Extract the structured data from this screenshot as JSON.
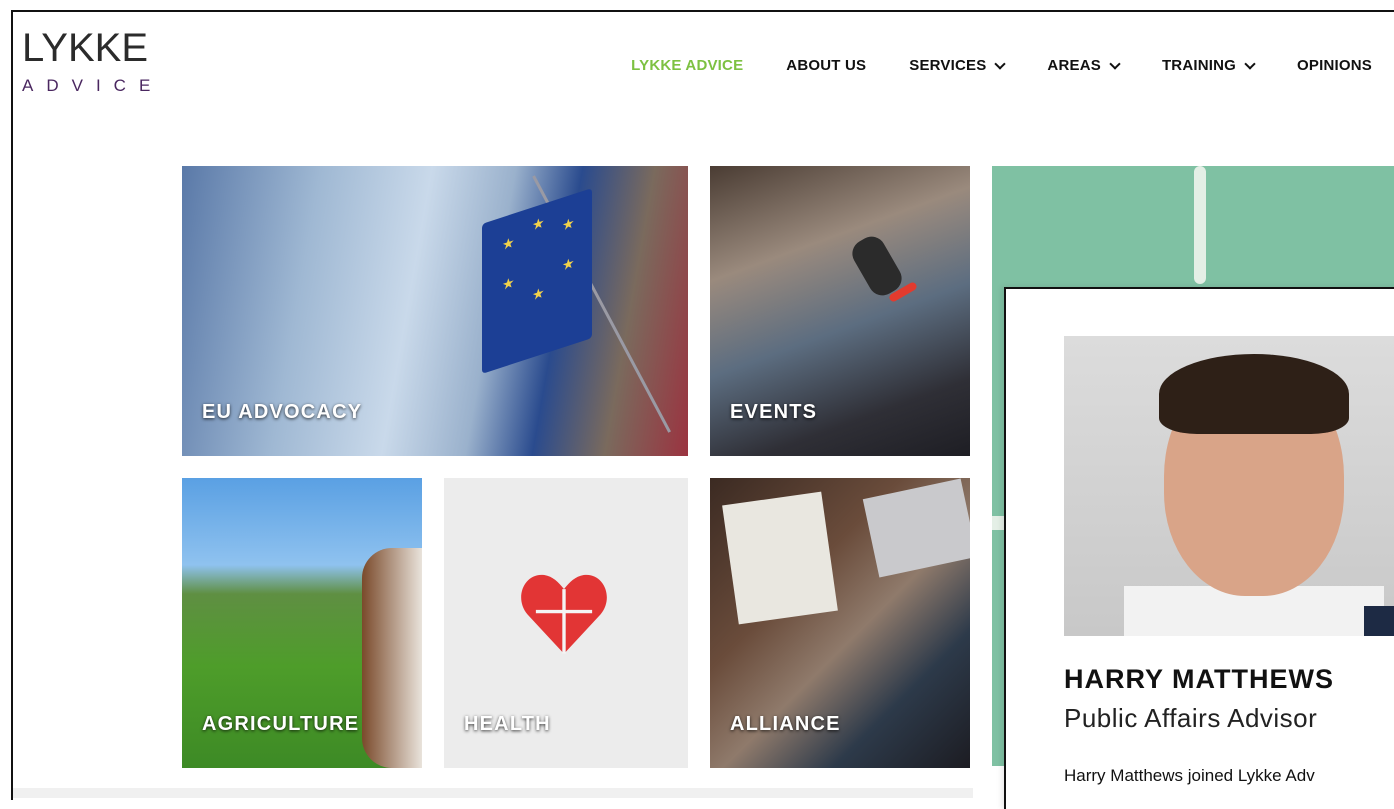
{
  "logo": {
    "top": "LYKKE",
    "bottom": "ADVICE"
  },
  "nav": [
    {
      "label": "LYKKE ADVICE",
      "active": true,
      "dropdown": false
    },
    {
      "label": "ABOUT US",
      "active": false,
      "dropdown": false
    },
    {
      "label": "SERVICES",
      "active": false,
      "dropdown": true
    },
    {
      "label": "AREAS",
      "active": false,
      "dropdown": true
    },
    {
      "label": "TRAINING",
      "active": false,
      "dropdown": true
    },
    {
      "label": "OPINIONS",
      "active": false,
      "dropdown": false
    }
  ],
  "tiles": {
    "eu": "EU ADVOCACY",
    "events": "EVENTS",
    "agriculture": "AGRICULTURE",
    "health": "HEALTH",
    "alliance": "ALLIANCE"
  },
  "profile": {
    "name": "HARRY MATTHEWS",
    "role": "Public Affairs Advisor",
    "bio": "Harry Matthews joined Lykke Adv"
  },
  "colors": {
    "accent": "#7dc142",
    "logo_purple": "#4a2760",
    "panel_green": "#7fc1a3"
  }
}
